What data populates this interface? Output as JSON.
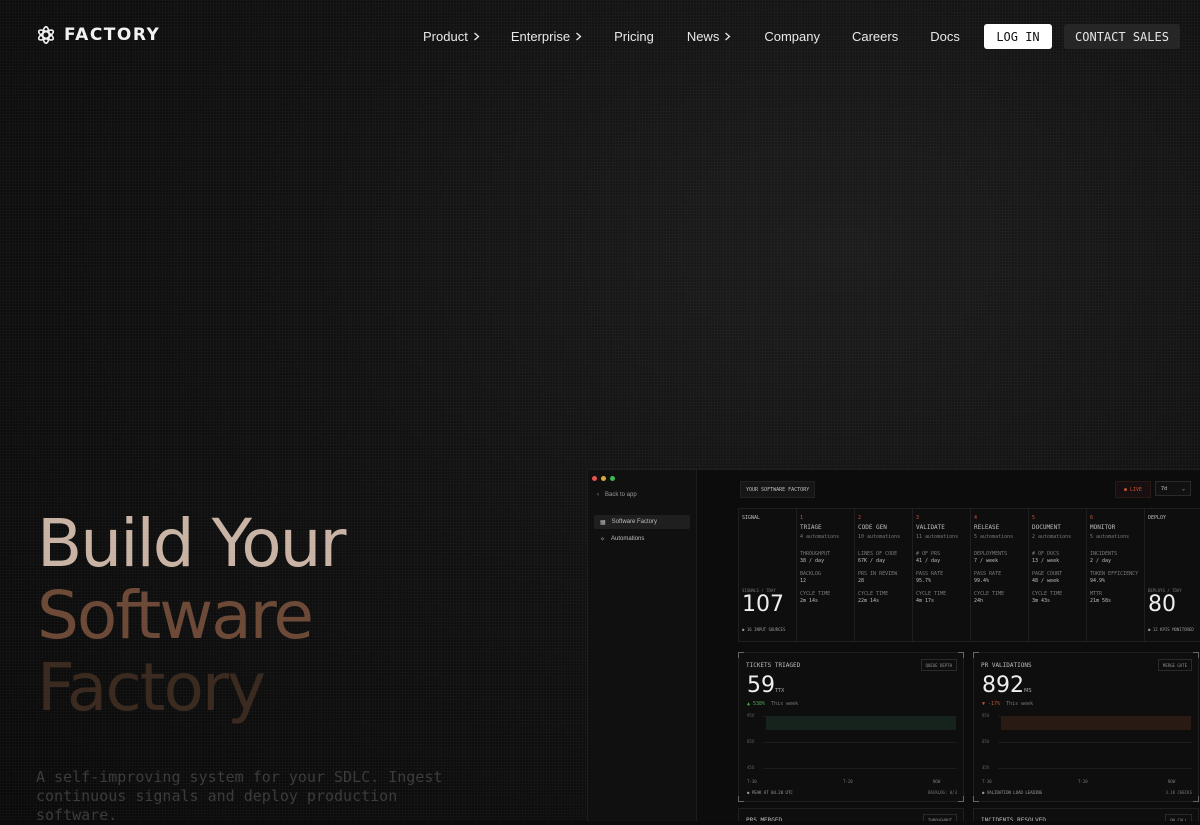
{
  "brand": {
    "name": "FACTORY"
  },
  "nav": {
    "items": [
      {
        "label": "Product",
        "has_chevron": true
      },
      {
        "label": "Enterprise",
        "has_chevron": true
      },
      {
        "label": "Pricing",
        "has_chevron": false
      },
      {
        "label": "News",
        "has_chevron": true
      },
      {
        "label": "Company",
        "has_chevron": false
      },
      {
        "label": "Careers",
        "has_chevron": false
      },
      {
        "label": "Docs",
        "has_chevron": false
      }
    ],
    "login_label": "LOG IN",
    "contact_label": "CONTACT SALES"
  },
  "hero": {
    "line1": "Build Your",
    "line2": "Software",
    "line3": "Factory",
    "subtitle": "A self-improving system for your SDLC. Ingest continuous signals and deploy production software."
  },
  "app": {
    "sidebar": {
      "back_label": "Back to app",
      "items": [
        {
          "label": "Software Factory",
          "active": true
        },
        {
          "label": "Automations",
          "active": false
        }
      ]
    },
    "title": "YOUR SOFTWARE FACTORY",
    "live_label": "● LIVE",
    "range_label": "7d",
    "pipeline": {
      "signal": {
        "label": "SIGNAL",
        "metric": "SIGNALS / 7DAY",
        "value": "107",
        "footer": "● 16 INPUT SOURCES"
      },
      "stages": [
        {
          "num": "1",
          "name": "TRIAGE",
          "sub": "4 automations",
          "m1": "THROUGHPUT",
          "v1": "38 / day",
          "m2": "BACKLOG",
          "v2": "12",
          "m3": "CYCLE TIME",
          "v3": "2m 14s"
        },
        {
          "num": "2",
          "name": "CODE GEN",
          "sub": "10 automations",
          "m1": "LINES OF CODE",
          "v1": "67K / day",
          "m2": "PRS IN REVIEW",
          "v2": "28",
          "m3": "CYCLE TIME",
          "v3": "22m 14s"
        },
        {
          "num": "3",
          "name": "VALIDATE",
          "sub": "11 automations",
          "m1": "# OF PRS",
          "v1": "41 / day",
          "m2": "PASS RATE",
          "v2": "95.7%",
          "m3": "CYCLE TIME",
          "v3": "4m 17s"
        },
        {
          "num": "4",
          "name": "RELEASE",
          "sub": "5 automations",
          "m1": "DEPLOYMENTS",
          "v1": "7 / week",
          "m2": "PASS RATE",
          "v2": "99.4%",
          "m3": "CYCLE TIME",
          "v3": "24h"
        },
        {
          "num": "5",
          "name": "DOCUMENT",
          "sub": "2 automations",
          "m1": "# OF DOCS",
          "v1": "13 / week",
          "m2": "PAGE COUNT",
          "v2": "48 / week",
          "m3": "CYCLE TIME",
          "v3": "3m 43s"
        },
        {
          "num": "6",
          "name": "MONITOR",
          "sub": "5 automations",
          "m1": "INCIDENTS",
          "v1": "2 / day",
          "m2": "TOKEN EFFICIENCY",
          "v2": "94.9%",
          "m3": "MTTR",
          "v3": "21m 58s"
        }
      ],
      "deploy": {
        "label": "DEPLOY",
        "metric": "DEPLOYS / 7DAY",
        "value": "80",
        "footer": "● 12 KPIS MONITORED"
      }
    },
    "cards": [
      {
        "title": "TICKETS TRIAGED",
        "tag": "QUEUE DEPTH",
        "value": "59",
        "unit": "TTX",
        "delta": "▲ 538%",
        "delta_note": "This week",
        "delta_color": "#4caf50",
        "bar_color": "#16231d",
        "grid": [
          "95X",
          "65X",
          "45X"
        ],
        "xticks": [
          "T-30",
          "T-20",
          "NOW"
        ],
        "footer": "● PEAK AT 04.20 UTC",
        "footer2": "BACKLOG: 0/3"
      },
      {
        "title": "PR VALIDATIONS",
        "tag": "MERGE GATE",
        "value": "892",
        "unit": "MS",
        "delta": "▼ -17%",
        "delta_note": "This week",
        "delta_color": "#c4553a",
        "bar_color": "#2a1a14",
        "grid": [
          "95X",
          "65X",
          "45X"
        ],
        "xticks": [
          "T-30",
          "T-20",
          "NOW"
        ],
        "footer": "● VALIDATION LOAD LEADING",
        "footer2": "3.1K CHECKS"
      }
    ],
    "bottom_cards": [
      {
        "title": "PRS MERGED",
        "tag": "THROUGHPUT"
      },
      {
        "title": "INCIDENTS RESOLVED",
        "tag": "ON CALL"
      }
    ]
  }
}
